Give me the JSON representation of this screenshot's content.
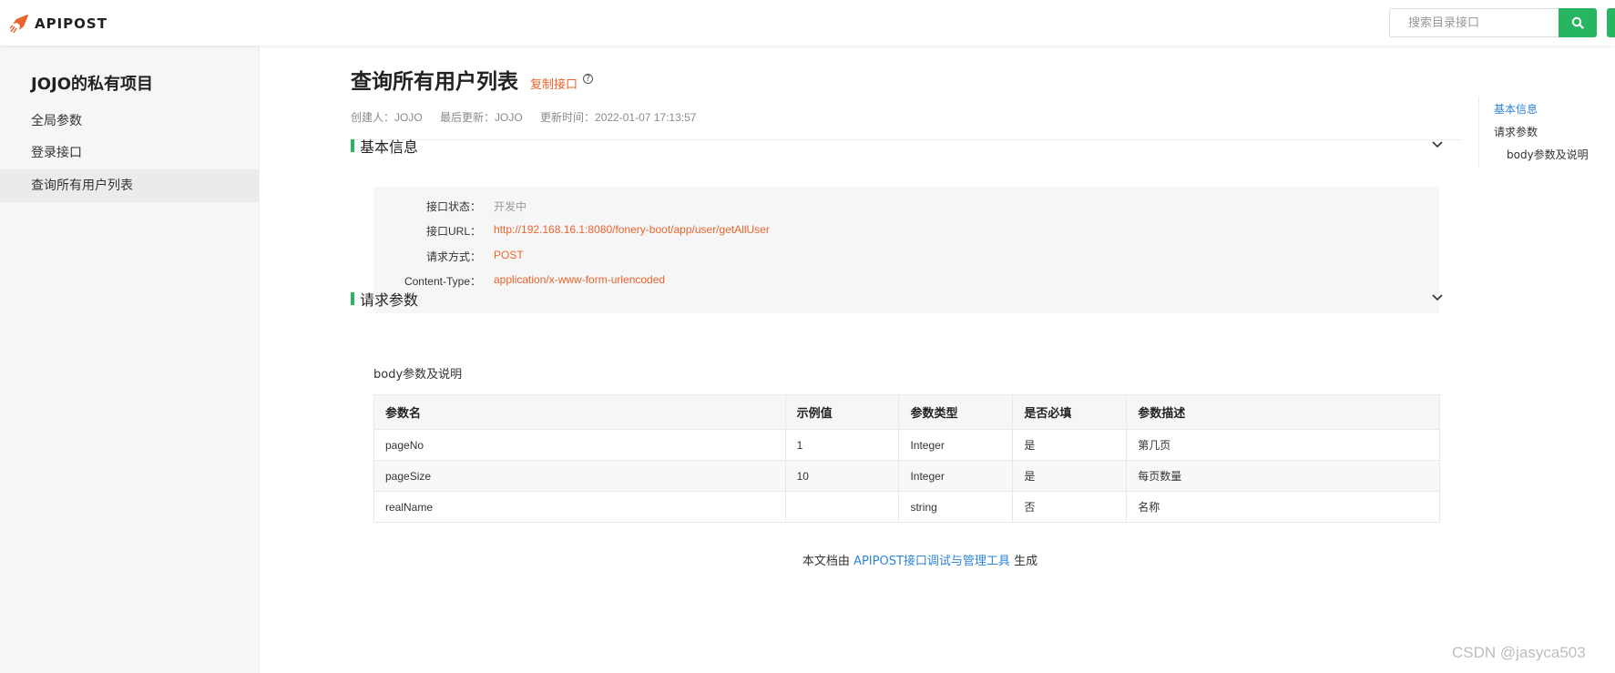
{
  "header": {
    "logo_text": "APIPOST",
    "search_placeholder": "搜索目录接口"
  },
  "sidebar": {
    "project_title": "JOJO的私有项目",
    "items": [
      {
        "label": "全局参数"
      },
      {
        "label": "登录接口"
      },
      {
        "label": "查询所有用户列表"
      }
    ]
  },
  "main": {
    "title": "查询所有用户列表",
    "copy_label": "复制接口",
    "help_glyph": "?",
    "meta": {
      "creator": "创建人：JOJO",
      "last_updater": "最后更新：JOJO",
      "updated_at": "更新时间：2022-01-07 17:13:57"
    },
    "basic_info": {
      "title": "基本信息",
      "rows": [
        {
          "label": "接口状态：",
          "value": "开发中"
        },
        {
          "label": "接口URL：",
          "value": "http://192.168.16.1:8080/fonery-boot/app/user/getAllUser"
        },
        {
          "label": "请求方式：",
          "value": "POST"
        },
        {
          "label": "Content-Type：",
          "value": "application/x-www-form-urlencoded"
        }
      ]
    },
    "request_params": {
      "title": "请求参数",
      "body_label": "body参数及说明",
      "columns": [
        "参数名",
        "示例值",
        "参数类型",
        "是否必填",
        "参数描述"
      ],
      "rows": [
        [
          "pageNo",
          "1",
          "Integer",
          "是",
          "第几页"
        ],
        [
          "pageSize",
          "10",
          "Integer",
          "是",
          "每页数量"
        ],
        [
          "realName",
          "",
          "string",
          "否",
          "名称"
        ]
      ]
    },
    "footer": {
      "prefix": "本文档由",
      "link": "APIPOST接口调试与管理工具",
      "suffix": "生成"
    }
  },
  "toc": {
    "items": [
      {
        "label": "基本信息"
      },
      {
        "label": "请求参数"
      },
      {
        "label": "body参数及说明"
      }
    ]
  },
  "watermark": "CSDN @jasyca503",
  "colors": {
    "accent_green": "#27b55f",
    "accent_orange": "#e8642c",
    "link_blue": "#2e84d6"
  }
}
